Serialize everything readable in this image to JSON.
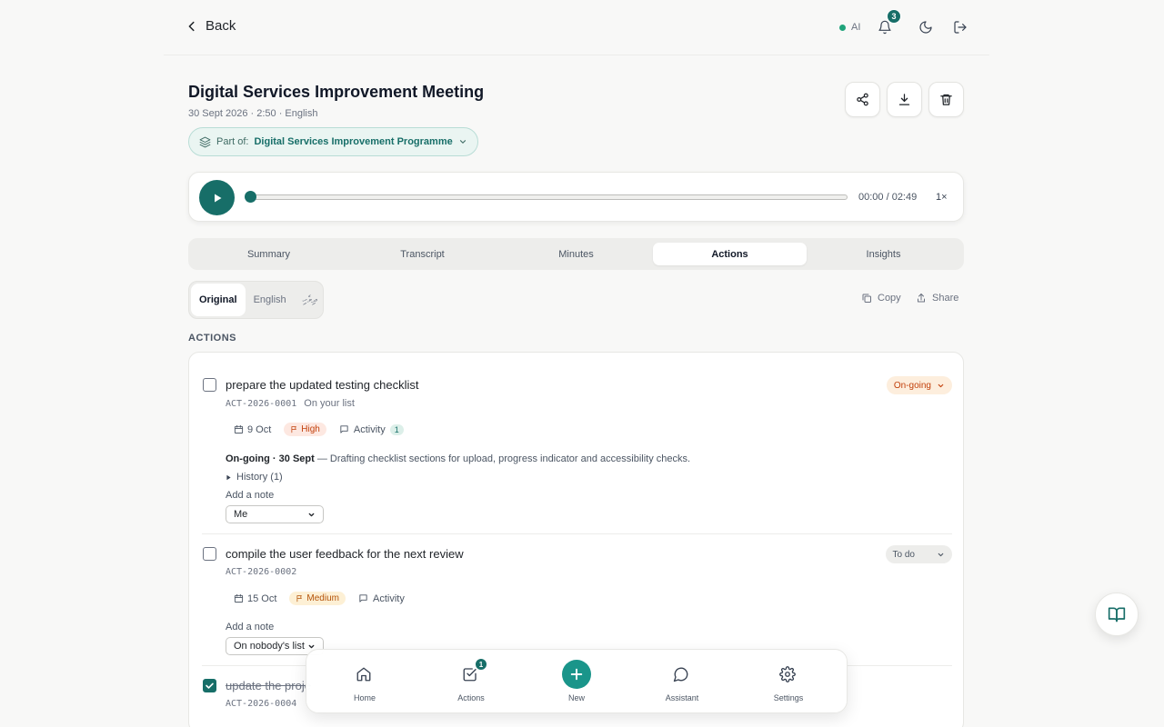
{
  "header": {
    "back_label": "Back",
    "ai_label": "AI",
    "notifications_count": "3"
  },
  "meeting": {
    "title": "Digital Services Improvement Meeting",
    "meta": "30 Sept 2026 · 2:50 · English",
    "part_of_label": "Part of:",
    "programme": "Digital Services Improvement Programme"
  },
  "player": {
    "time": "00:00 / 02:49",
    "speed": "1×",
    "progress": 0
  },
  "tabs": [
    {
      "label": "Summary"
    },
    {
      "label": "Transcript"
    },
    {
      "label": "Minutes"
    },
    {
      "label": "Actions"
    },
    {
      "label": "Insights"
    }
  ],
  "active_tab": "Actions",
  "language": {
    "options": [
      "Original",
      "English",
      "ދިވެހި"
    ],
    "active": "Original"
  },
  "toolbar": {
    "copy_label": "Copy",
    "share_label": "Share"
  },
  "actions_heading": "ACTIONS",
  "actions": [
    {
      "title": "prepare the updated testing checklist",
      "code": "ACT-2026-0001",
      "on_list": "On your list",
      "date": "9 Oct",
      "priority": "High",
      "activity_label": "Activity",
      "activity_count": "1",
      "status": "On-going",
      "update_prefix": "On-going · 30 Sept",
      "update_text": " — Drafting checklist sections for upload, progress indicator and accessibility checks.",
      "history": "History (1)",
      "note_label": "Add a note",
      "assignee": "Me",
      "checked": false
    },
    {
      "title": "compile the user feedback for the next review",
      "code": "ACT-2026-0002",
      "date": "15 Oct",
      "priority": "Medium",
      "activity_label": "Activity",
      "status": "To do",
      "note_label": "Add a note",
      "assignee": "On nobody's list",
      "checked": false
    },
    {
      "title": "update the proje",
      "code": "ACT-2026-0004",
      "checked": true
    }
  ],
  "bottom_nav": [
    {
      "label": "Home",
      "icon": "home-icon"
    },
    {
      "label": "Actions",
      "icon": "checkbox-icon",
      "badge": "1"
    },
    {
      "label": "New",
      "icon": "plus-icon"
    },
    {
      "label": "Assistant",
      "icon": "chat-bubble-icon"
    },
    {
      "label": "Settings",
      "icon": "gear-icon"
    }
  ],
  "colors": {
    "accent": "#176e68",
    "accent_light": "#1a958a",
    "background": "#f8f8f7"
  }
}
